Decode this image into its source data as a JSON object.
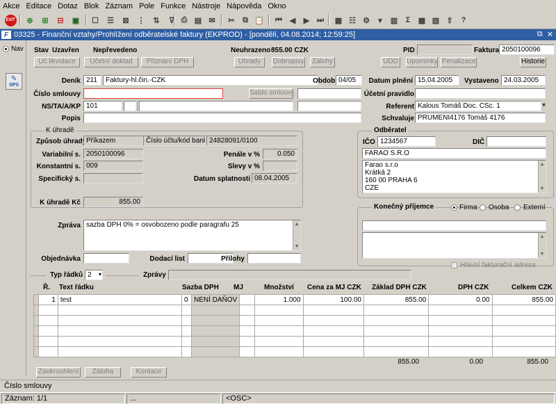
{
  "menu": [
    "Akce",
    "Editace",
    "Dotaz",
    "Blok",
    "Záznam",
    "Pole",
    "Funkce",
    "Nástroje",
    "Nápověda",
    "Okno"
  ],
  "toolbar": {
    "exit_label": "EXIT"
  },
  "window": {
    "title": "03325 - Finanční vztahy/Prohlížení odběratelské faktury (EKPROD) - [pondělí, 04.08.2014; 12:59:25]"
  },
  "nav": {
    "nav_label": "Nav",
    "sps_label": "SPS"
  },
  "header": {
    "stav_label": "Stav",
    "stav_value": "Uzavřen",
    "neprevedeno": "Nepřevedeno",
    "neuhrazeno_label": "Neuhrazeno",
    "neuhrazeno_value": "855.00 CZK",
    "pid_label": "PID",
    "faktura_label": "Faktura",
    "faktura_value": "2050100096",
    "buttons": {
      "uc_likvidace": "Úč.likvidace",
      "ucetni_doklad": "Účetní doklad",
      "priznani_dph": "Přiznání DPH",
      "uhrady": "Úhrady",
      "dobropisy": "Dobropisy",
      "zalohy": "Zálohy",
      "udd": "UDD",
      "upominky": "Upomínky",
      "penalizace": "Penalizace",
      "historie": "Historie"
    }
  },
  "form": {
    "denik_label": "Deník",
    "denik_code": "211",
    "denik_name": "Faktury-hl.čin.-CZK",
    "obdobi_label": "Období",
    "obdobi_value": "04/05",
    "datum_plneni_label": "Datum plnění",
    "datum_plneni_value": "15.04.2005",
    "vystaveno_label": "Vystaveno",
    "vystaveno_value": "24.03.2005",
    "cislo_smlouvy_label": "Číslo smlouvy",
    "saldo_smlouvy_label": "Saldo smlouvy",
    "ucetni_pravidlo_label": "Účetní pravidlo",
    "ns_label": "NS/TA/A/KP",
    "ns_value": "101",
    "referent_label": "Referent",
    "referent_value": "Kalous Tomáš Doc. CSc. 1",
    "popis_label": "Popis",
    "schvaluje_label": "Schvaluje",
    "schvaluje_value": "PRUMENI4176 Tomáš 4176"
  },
  "kuhrade": {
    "group_title": "K úhradě",
    "zpusob_label": "Způsob úhrady",
    "zpusob_value": "Příkazem",
    "cislo_uctu_label": "Číslo účtu/kód banky",
    "cislo_uctu_value": "24828091/0100",
    "variabilni_label": "Variabilní s.",
    "variabilni_value": "2050100096",
    "penale_label": "Penále v %",
    "penale_value": "0.050",
    "konstantni_label": "Konstantní s.",
    "konstantni_value": "009",
    "slevy_label": "Slevy v %",
    "specificky_label": "Specifický s.",
    "datum_splatnosti_label": "Datum splatnosti",
    "datum_splatnosti_value": "08.04.2005",
    "k_uhrade_label": "K úhradě Kč",
    "k_uhrade_value": "855.00"
  },
  "odberatel": {
    "group_title": "Odběratel",
    "ico_label": "IČO",
    "ico_value": "1234567",
    "dic_label": "DIČ",
    "name_value": "FARAO S.R.O",
    "address_lines": [
      "Farao s.r.o",
      "Krátká 2",
      "160 00 PRAHA 6",
      "CZE"
    ]
  },
  "prijemce": {
    "group_title": "Konečný příjemce",
    "options": [
      "Firma",
      "Osoba",
      "Externí"
    ],
    "hlavni_label": "Hlavní fakturační adresa"
  },
  "zprava": {
    "label": "Zpráva",
    "value": "sazba DPH 0% = osvobozeno podle paragrafu 25",
    "objednavka_label": "Objednávka",
    "dodaci_list_label": "Dodací list",
    "prilohy_label": "Přílohy"
  },
  "typ_radku": {
    "label": "Typ řádků",
    "value": "2",
    "zpravy_label": "Zprávy"
  },
  "grid": {
    "headers": {
      "r": "Ř.",
      "text": "Text řádku",
      "sazba": "Sazba DPH",
      "mj": "MJ",
      "mnozstvi": "Množství",
      "cena": "Cena za MJ CZK",
      "zaklad": "Základ DPH CZK",
      "dph": "DPH CZK",
      "celkem": "Celkem CZK"
    },
    "rows": [
      {
        "r": "1",
        "text": "test",
        "sazba_code": "0",
        "sazba_name": "NENÍ DAŇOV",
        "mj": "",
        "mnozstvi": "1.000",
        "cena": "100.00",
        "zaklad": "855.00",
        "dph": "0.00",
        "celkem": "855.00"
      }
    ],
    "totals": {
      "zaklad": "855.00",
      "dph": "0.00",
      "celkem": "855.00"
    }
  },
  "footer_buttons": {
    "zaokrouhleni": "Zaokrouhlení",
    "zaloha": "Záloha",
    "kontace": "Kontace"
  },
  "status": {
    "field_hint": "Číslo smlouvy",
    "record": "Záznam: 1/1",
    "dots": "...",
    "osc": "<OSC>"
  }
}
